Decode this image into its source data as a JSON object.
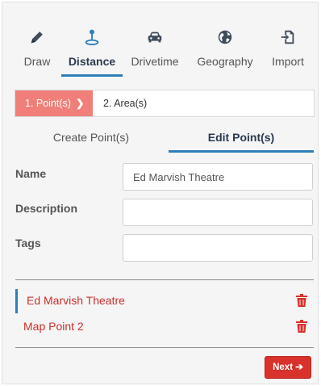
{
  "toolbar": {
    "tools": [
      {
        "label": "Draw",
        "icon": "pencil-icon"
      },
      {
        "label": "Distance",
        "icon": "map-pin-icon"
      },
      {
        "label": "Drivetime",
        "icon": "car-icon"
      },
      {
        "label": "Geography",
        "icon": "globe-icon"
      },
      {
        "label": "Import",
        "icon": "import-icon"
      }
    ],
    "active": "Distance"
  },
  "steps": {
    "step1": "1. Point(s)",
    "step2": "2. Area(s)"
  },
  "subtabs": {
    "create": "Create Point(s)",
    "edit": "Edit Point(s)",
    "active": "Edit Point(s)"
  },
  "form": {
    "name_label": "Name",
    "name_value": "Ed Marvish Theatre",
    "description_label": "Description",
    "description_value": "",
    "tags_label": "Tags",
    "tags_value": ""
  },
  "points": [
    {
      "name": "Ed Marvish Theatre",
      "selected": true
    },
    {
      "name": "Map Point 2",
      "selected": false
    }
  ],
  "next_button": {
    "label": "Next",
    "icon": "arrow-right-icon"
  },
  "colors": {
    "accent_blue": "#2e7fb8",
    "step_active": "#ef7f78",
    "danger_red": "#d9312b",
    "panel_bg": "#f5f5f6"
  }
}
